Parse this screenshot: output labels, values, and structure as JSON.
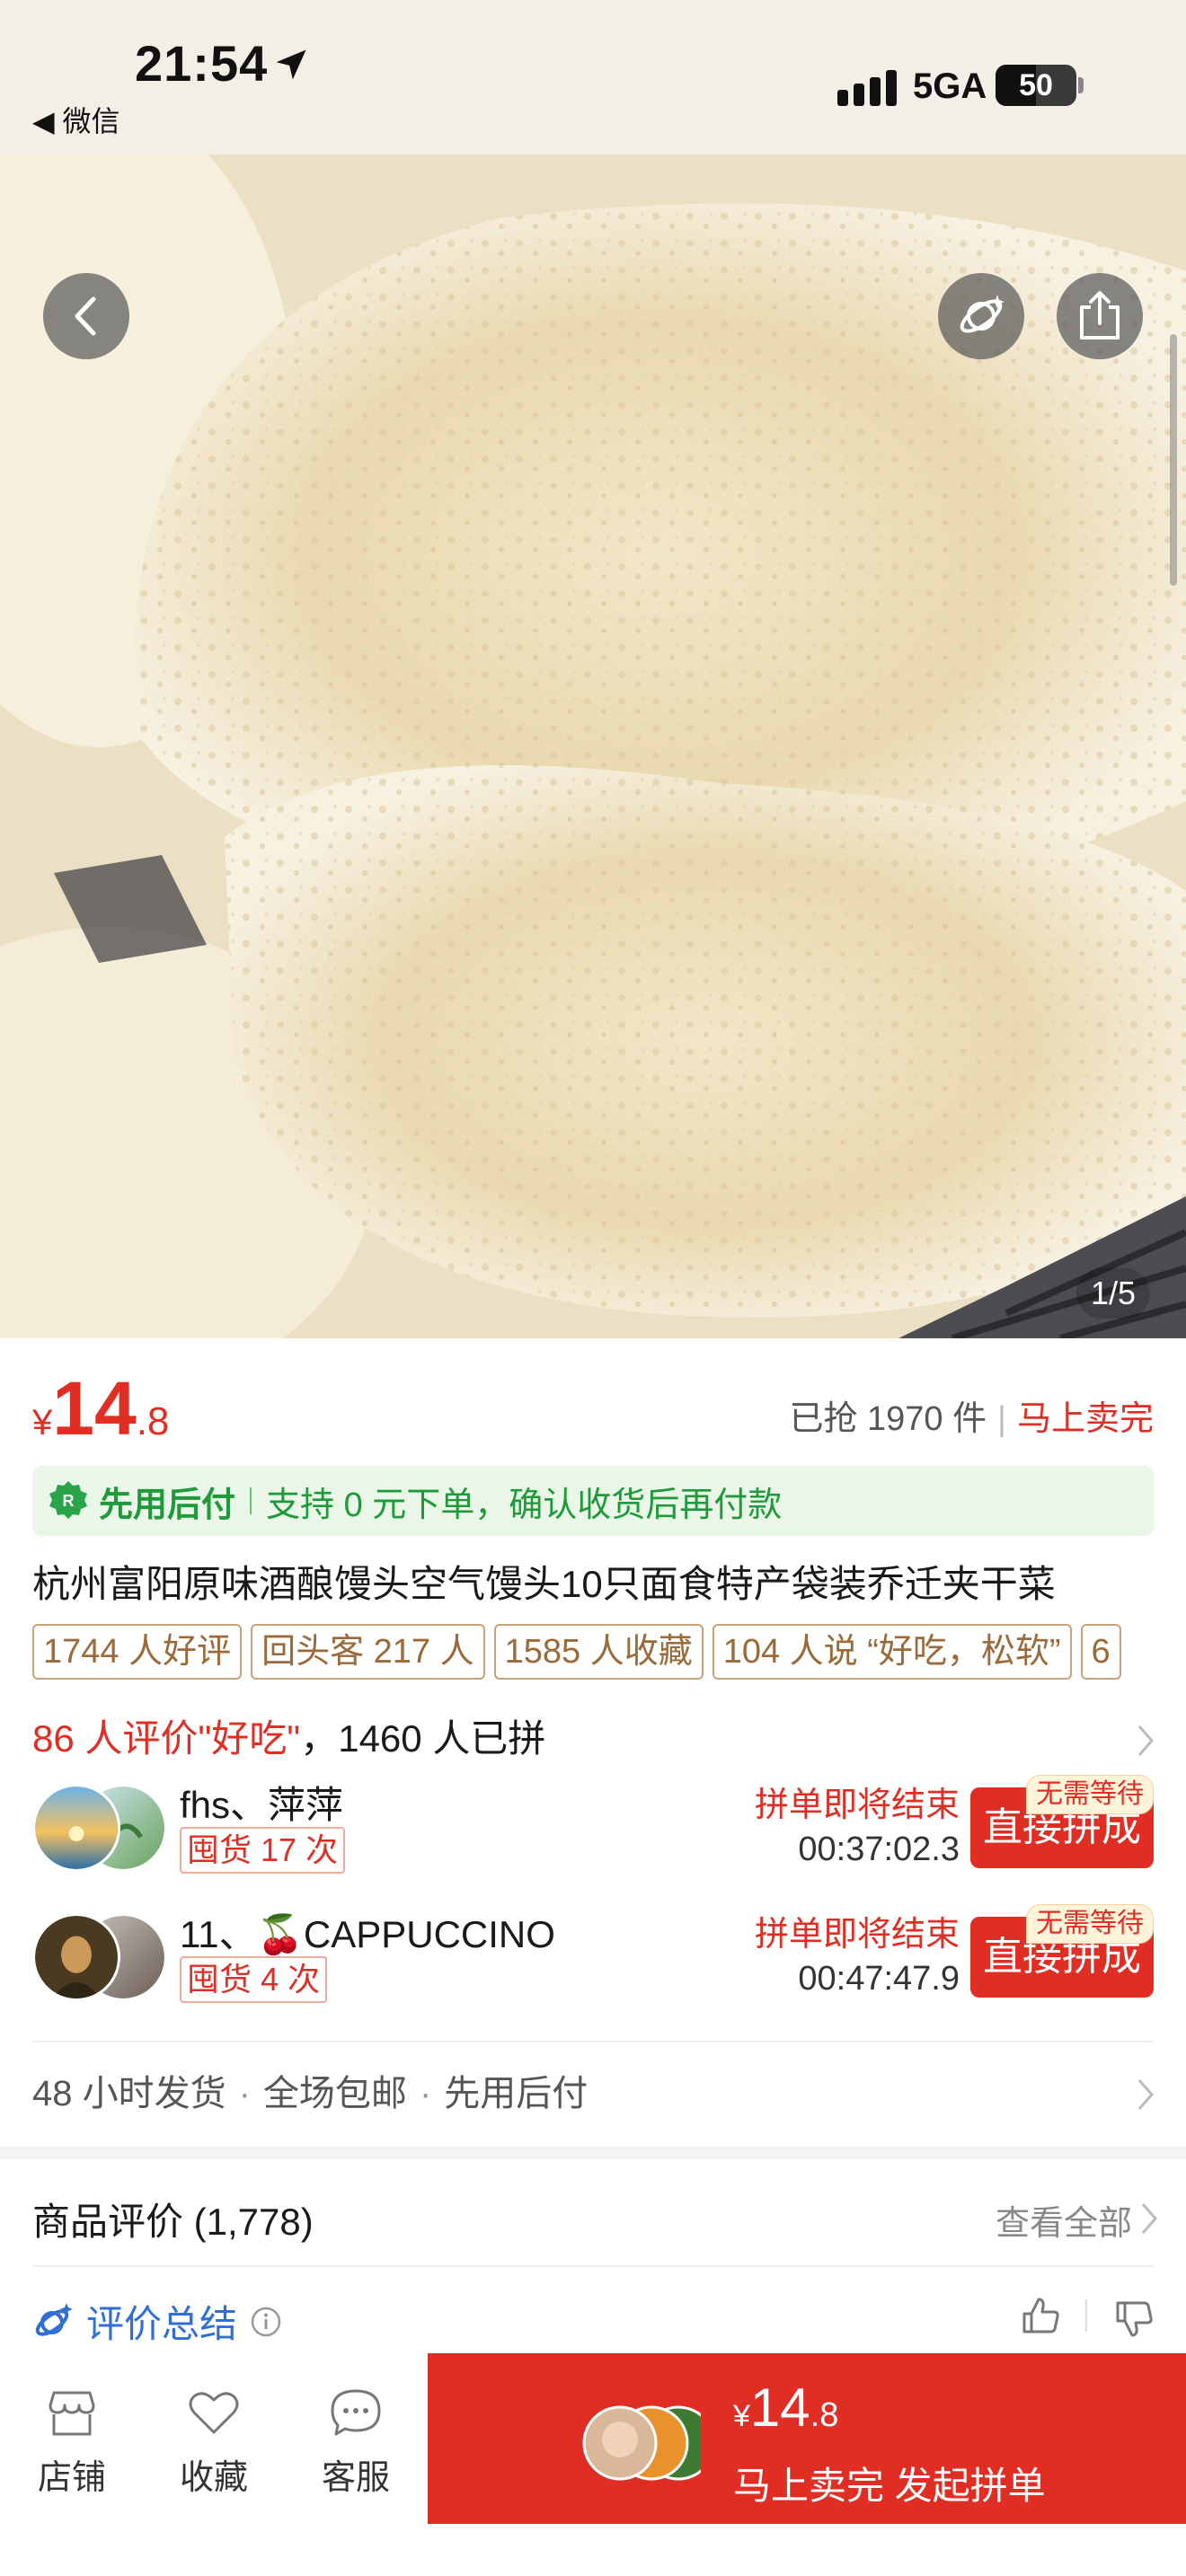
{
  "status_bar": {
    "time": "21:54",
    "back_app": "◀ 微信",
    "network": "5GA",
    "battery": "50",
    "battery_level": 0.5
  },
  "hero": {
    "pager": "1/5"
  },
  "product": {
    "currency": "¥",
    "price_int": "14",
    "price_dec": ".8",
    "sold_text": "已抢 1970 件",
    "sold_status": "马上卖完",
    "pay_label": "先用后付",
    "pay_desc": "支持 0 元下单，确认收货后再付款",
    "title": "杭州富阳原味酒酿馒头空气馒头10只面食特产袋装乔迁夹干菜",
    "tags": [
      "1744 人好评",
      "回头客 217 人",
      "1585 人收藏",
      "104 人说 “好吃，松软”",
      "6"
    ],
    "rating_red": "86 人评价\"好吃\"",
    "rating_rest": "，1460 人已拼"
  },
  "groups": [
    {
      "name": "fhs、萍萍",
      "badge": "囤货 17 次",
      "status": "拼单即将结束",
      "countdown": "00:37:02.3",
      "button": "直接拼成",
      "button_tag": "无需等待"
    },
    {
      "name": "11、🍒CAPPUCCINO",
      "badge": "囤货 4 次",
      "status": "拼单即将结束",
      "countdown": "00:47:47.9",
      "button": "直接拼成",
      "button_tag": "无需等待"
    }
  ],
  "shipping": [
    "48 小时发货",
    "全场包邮",
    "先用后付"
  ],
  "reviews": {
    "title": "商品评价 (1,778)",
    "view_all": "查看全部",
    "summary": "评价总结"
  },
  "bottom_bar": {
    "store": "店铺",
    "favorite": "收藏",
    "service": "客服",
    "buy_currency": "¥",
    "buy_price_int": "14",
    "buy_price_dec": ".8",
    "buy_label": "马上卖完 发起拼单"
  },
  "colors": {
    "accent_red": "#e02e24",
    "pay_green": "#1e9a3a",
    "tag_brown": "#9a6a3a",
    "summary_blue": "#2f6fd6"
  }
}
